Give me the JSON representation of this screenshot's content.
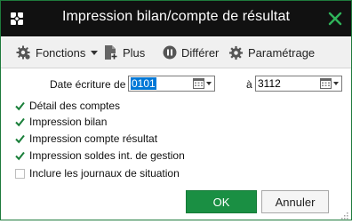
{
  "window": {
    "title": "Impression bilan/compte de résultat"
  },
  "toolbar": {
    "functions_label": "Fonctions",
    "plus_label": "Plus",
    "defer_label": "Différer",
    "settings_label": "Paramétrage"
  },
  "date": {
    "label_from": "Date écriture de",
    "from_value": "0101",
    "label_to": "à",
    "to_value": "3112"
  },
  "options": [
    {
      "label": "Détail des comptes",
      "checked": true
    },
    {
      "label": "Impression bilan",
      "checked": true
    },
    {
      "label": "Impression compte résultat",
      "checked": true
    },
    {
      "label": "Impression soldes int. de gestion",
      "checked": true
    },
    {
      "label": "Inclure les journaux de situation",
      "checked": false
    }
  ],
  "buttons": {
    "ok_label": "OK",
    "cancel_label": "Annuler"
  },
  "colors": {
    "accent": "#1a8f43",
    "titlebar": "#111111",
    "close_icon": "#2fb35a",
    "check": "#1a7f3a"
  }
}
